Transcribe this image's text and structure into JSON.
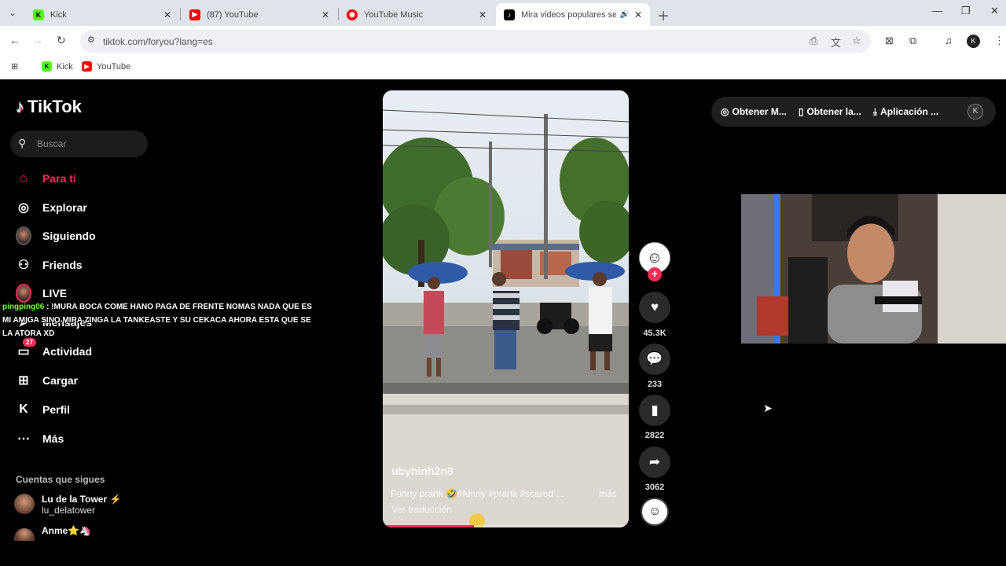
{
  "browser": {
    "tabs": [
      {
        "title": "Kick",
        "favicon_color": "#53fc18",
        "favicon_letter": "K"
      },
      {
        "title": "(87) YouTube",
        "favicon_color": "#ff0000",
        "favicon_letter": "▶"
      },
      {
        "title": "YouTube Music",
        "favicon_color": "#ff0000",
        "favicon_letter": "◉"
      },
      {
        "title": "Mira videos populares selec",
        "favicon_color": "#000000",
        "favicon_letter": "♪"
      }
    ],
    "url": "tiktok.com/foryou?lang=es",
    "bookmarks": [
      {
        "label": "Kick",
        "favicon_color": "#53fc18",
        "favicon_letter": "K"
      },
      {
        "label": "YouTube",
        "favicon_color": "#ff0000",
        "favicon_letter": "▶"
      }
    ]
  },
  "tiktok": {
    "logo": "TikTok",
    "search_placeholder": "Buscar",
    "nav": [
      {
        "label": "Para ti",
        "icon": "home-icon"
      },
      {
        "label": "Explorar",
        "icon": "compass-icon"
      },
      {
        "label": "Siguiendo",
        "icon": "avatar"
      },
      {
        "label": "Friends",
        "icon": "friends-icon"
      },
      {
        "label": "LIVE",
        "icon": "live-icon"
      },
      {
        "label": "Mensajes",
        "icon": "paper-plane-icon"
      },
      {
        "label": "Actividad",
        "icon": "inbox-icon",
        "badge": "27"
      },
      {
        "label": "Cargar",
        "icon": "plus-square-icon"
      },
      {
        "label": "Perfil",
        "icon": "profile-icon"
      },
      {
        "label": "Más",
        "icon": "more-icon"
      }
    ],
    "following_heading": "Cuentas que sigues",
    "following": [
      {
        "name": "Lu de la Tower ⚡",
        "handle": "lu_delatower"
      },
      {
        "name": "Anme⭐🦄",
        "handle": ""
      }
    ],
    "video": {
      "username": "ubyhinh2n8",
      "caption": "Funny prank 🤣#funny #prank #scared ...",
      "more": "más",
      "translate": "Ver traducción",
      "progress": 0.37
    },
    "actions": {
      "likes": "45.3K",
      "comments": "233",
      "saves": "2822",
      "shares": "3062"
    },
    "banner": [
      {
        "label": "Obtener M...",
        "icon": "coin-icon"
      },
      {
        "label": "Obtener la...",
        "icon": "phone-icon"
      },
      {
        "label": "Aplicación ...",
        "icon": "download-icon"
      }
    ]
  },
  "chat_overlay": {
    "user": "pingping06",
    "message": " : !MURA BOCA COME HANO PAGA DE FRENTE NOMAS NADA QUE ES MI AMIGA SINO MIRA ZINGA LA TANKEASTE Y SU CEKACA AHORA ESTA QUE SE LA ATORA XD"
  }
}
